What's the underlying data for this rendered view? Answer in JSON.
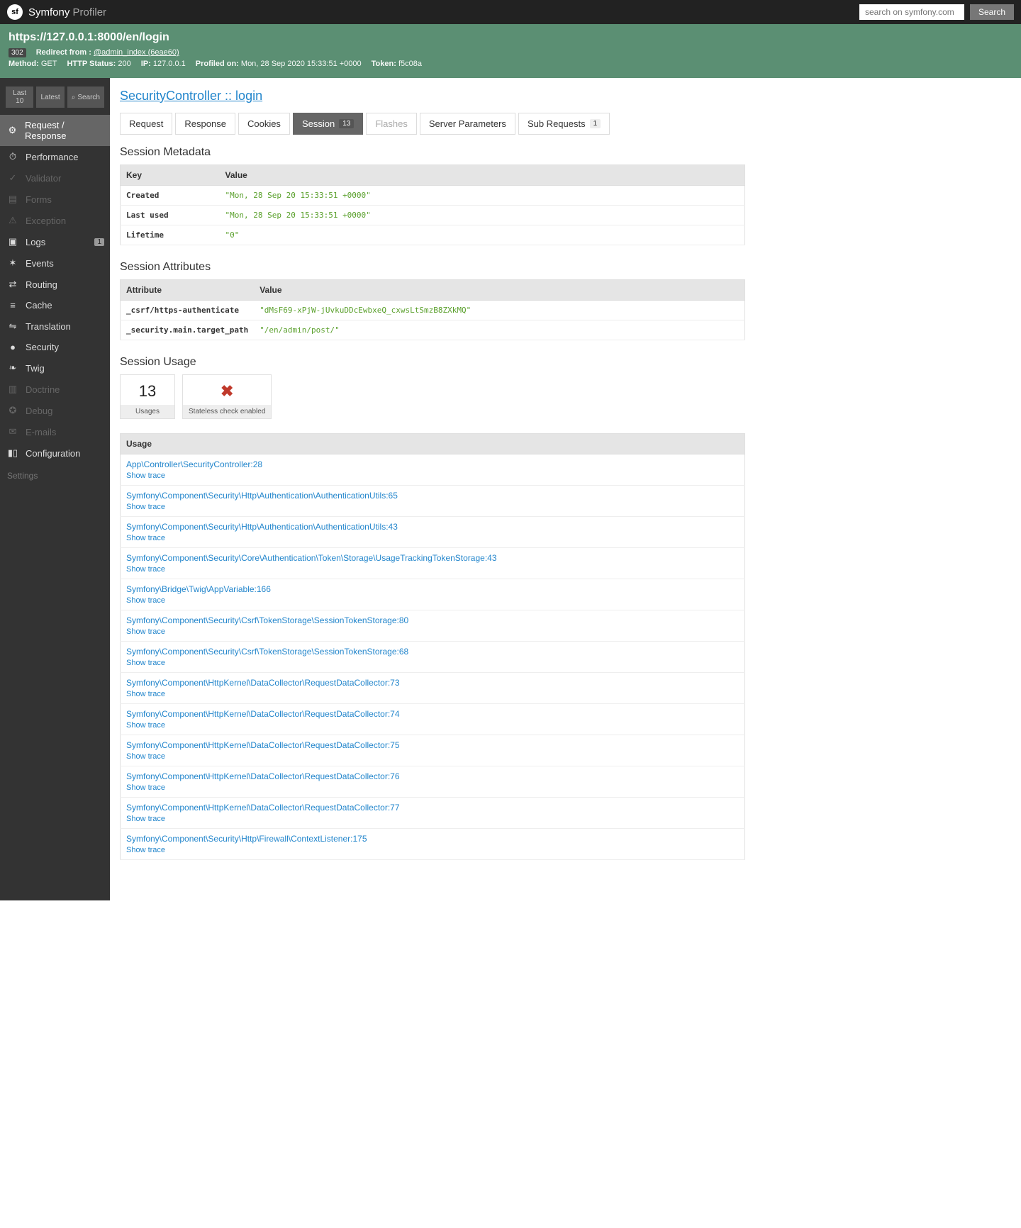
{
  "header": {
    "brand_strong": "Symfony",
    "brand_light": " Profiler",
    "search_placeholder": "search on symfony.com",
    "search_btn": "Search"
  },
  "summary": {
    "url": "https://127.0.0.1:8000/en/login",
    "status_code": "302",
    "redirect_label": "Redirect from :",
    "redirect_value": "@admin_index (6eae60)",
    "method_label": "Method:",
    "method_value": "GET",
    "http_status_label": "HTTP Status:",
    "http_status_value": "200",
    "ip_label": "IP:",
    "ip_value": "127.0.0.1",
    "profiled_label": "Profiled on:",
    "profiled_value": "Mon, 28 Sep 2020 15:33:51 +0000",
    "token_label": "Token:",
    "token_value": "f5c08a"
  },
  "sidebar": {
    "last10": "Last 10",
    "latest": "Latest",
    "search": "Search",
    "items": [
      {
        "label": "Request / Response",
        "state": "selected"
      },
      {
        "label": "Performance"
      },
      {
        "label": "Validator",
        "state": "disabled"
      },
      {
        "label": "Forms",
        "state": "disabled"
      },
      {
        "label": "Exception",
        "state": "disabled"
      },
      {
        "label": "Logs",
        "count": "1"
      },
      {
        "label": "Events"
      },
      {
        "label": "Routing"
      },
      {
        "label": "Cache"
      },
      {
        "label": "Translation"
      },
      {
        "label": "Security"
      },
      {
        "label": "Twig"
      },
      {
        "label": "Doctrine",
        "state": "disabled"
      },
      {
        "label": "Debug",
        "state": "disabled"
      },
      {
        "label": "E-mails",
        "state": "disabled"
      },
      {
        "label": "Configuration"
      }
    ],
    "settings": "Settings"
  },
  "title": "SecurityController :: login",
  "tabs": [
    {
      "label": "Request"
    },
    {
      "label": "Response"
    },
    {
      "label": "Cookies"
    },
    {
      "label": "Session",
      "badge": "13",
      "state": "active"
    },
    {
      "label": "Flashes",
      "state": "disabled"
    },
    {
      "label": "Server Parameters"
    },
    {
      "label": "Sub Requests",
      "badge": "1",
      "light": true
    }
  ],
  "session_metadata": {
    "title": "Session Metadata",
    "head_key": "Key",
    "head_value": "Value",
    "rows": [
      {
        "key": "Created",
        "value": "\"Mon, 28 Sep 20 15:33:51 +0000\""
      },
      {
        "key": "Last used",
        "value": "\"Mon, 28 Sep 20 15:33:51 +0000\""
      },
      {
        "key": "Lifetime",
        "value": "\"0\""
      }
    ]
  },
  "session_attributes": {
    "title": "Session Attributes",
    "head_key": "Attribute",
    "head_value": "Value",
    "rows": [
      {
        "key": "_csrf/https-authenticate",
        "value": "\"dMsF69-xPjW-jUvkuDDcEwbxeQ_cxwsLtSmzB8ZXkMQ\""
      },
      {
        "key": "_security.main.target_path",
        "value": "\"/en/admin/post/\""
      }
    ]
  },
  "session_usage": {
    "title": "Session Usage",
    "metrics": [
      {
        "big": "13",
        "label": "Usages"
      },
      {
        "big": "✖",
        "label": "Stateless check enabled",
        "red": true
      }
    ],
    "head": "Usage",
    "trace_label": "Show trace",
    "rows": [
      "App\\Controller\\SecurityController:28",
      "Symfony\\Component\\Security\\Http\\Authentication\\AuthenticationUtils:65",
      "Symfony\\Component\\Security\\Http\\Authentication\\AuthenticationUtils:43",
      "Symfony\\Component\\Security\\Core\\Authentication\\Token\\Storage\\UsageTrackingTokenStorage:43",
      "Symfony\\Bridge\\Twig\\AppVariable:166",
      "Symfony\\Component\\Security\\Csrf\\TokenStorage\\SessionTokenStorage:80",
      "Symfony\\Component\\Security\\Csrf\\TokenStorage\\SessionTokenStorage:68",
      "Symfony\\Component\\HttpKernel\\DataCollector\\RequestDataCollector:73",
      "Symfony\\Component\\HttpKernel\\DataCollector\\RequestDataCollector:74",
      "Symfony\\Component\\HttpKernel\\DataCollector\\RequestDataCollector:75",
      "Symfony\\Component\\HttpKernel\\DataCollector\\RequestDataCollector:76",
      "Symfony\\Component\\HttpKernel\\DataCollector\\RequestDataCollector:77",
      "Symfony\\Component\\Security\\Http\\Firewall\\ContextListener:175"
    ]
  }
}
